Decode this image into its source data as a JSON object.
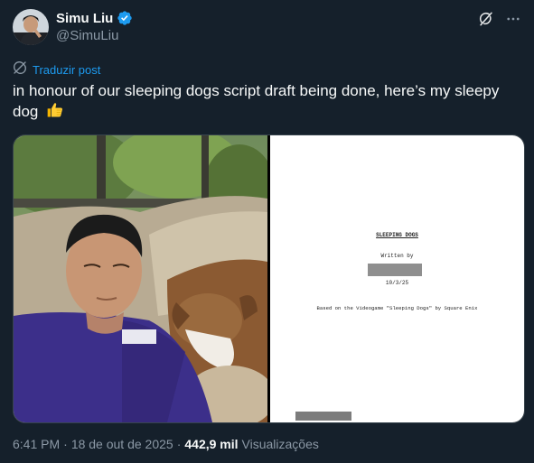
{
  "author": {
    "name": "Simu Liu",
    "handle": "@SimuLiu",
    "verified": true,
    "verified_color": "#1d9bf0"
  },
  "top_actions": {
    "grok_icon": "grok-icon",
    "more_icon": "more-icon"
  },
  "translate": {
    "label": "Traduzir post",
    "icon": "translate-icon"
  },
  "tweet": {
    "text": "in honour of our sleeping dogs script draft being done, here’s my sleepy dog",
    "emoji": "thumbs-up"
  },
  "media": {
    "photo_desc_icon": "selfie-with-dog-photo",
    "script_page": {
      "title": "SLEEPING DOGS",
      "written_by": "Written by",
      "date": "10/3/25",
      "based_on": "Based on the Videogame \"Sleeping Dogs\" by Square Enix"
    }
  },
  "meta": {
    "time": "6:41 PM",
    "date": "18 de out de 2025",
    "separator": "·",
    "views_count": "442,9 mil",
    "views_label": "Visualizações"
  },
  "colors": {
    "background": "#15202b",
    "accent": "#1d9bf0",
    "secondary_text": "#8b98a5"
  }
}
